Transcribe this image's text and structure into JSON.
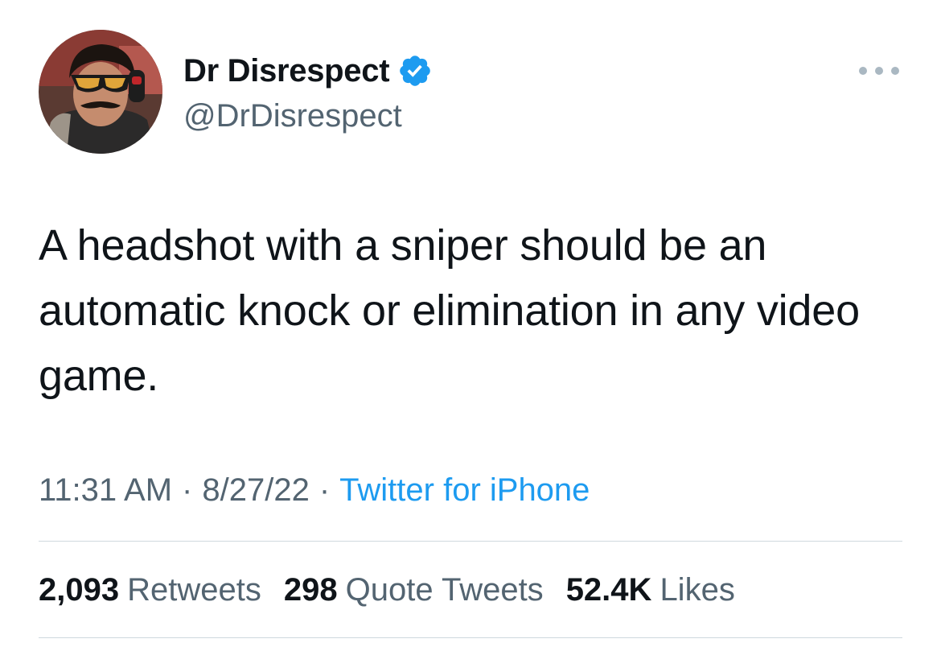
{
  "author": {
    "display_name": "Dr Disrespect",
    "handle": "@DrDisrespect",
    "verified": true,
    "avatar_icon": "avatar-photo"
  },
  "tweet": {
    "text": "A headshot with a sniper should be an automatic knock or elimination in any video game.",
    "time": "11:31 AM",
    "date": "8/27/22",
    "separator": "·",
    "source": "Twitter for iPhone"
  },
  "stats": {
    "retweets": {
      "count": "2,093",
      "label": "Retweets"
    },
    "quotes": {
      "count": "298",
      "label": "Quote Tweets"
    },
    "likes": {
      "count": "52.4K",
      "label": "Likes"
    }
  },
  "colors": {
    "text_primary": "#0f1419",
    "text_secondary": "#536471",
    "link": "#1d9bf0",
    "verified_badge": "#1d9bf0",
    "divider": "#cfd9de"
  },
  "icons": {
    "more": "more-horizontal-icon",
    "verified": "verified-badge-icon"
  }
}
